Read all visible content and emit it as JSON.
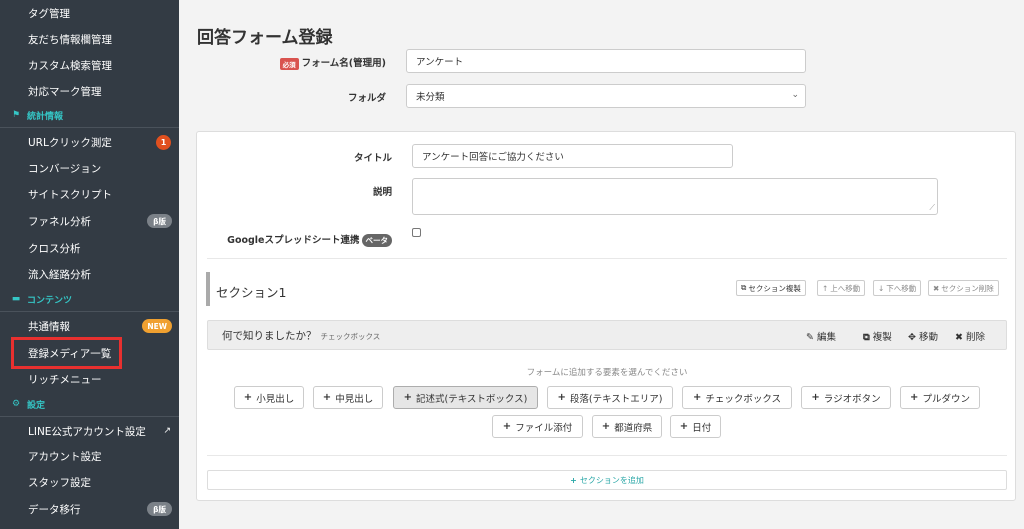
{
  "sidebar": {
    "items": [
      {
        "label": "タグ管理"
      },
      {
        "label": "友だち情報欄管理"
      },
      {
        "label": "カスタム検索管理"
      },
      {
        "label": "対応マーク管理"
      }
    ],
    "stats_section": {
      "label": "統計情報"
    },
    "stats_items": [
      {
        "label": "URLクリック測定",
        "badge": "1"
      },
      {
        "label": "コンバージョン"
      },
      {
        "label": "サイトスクリプト"
      },
      {
        "label": "ファネル分析",
        "badge": "β版"
      },
      {
        "label": "クロス分析"
      },
      {
        "label": "流入経路分析"
      }
    ],
    "content_section": {
      "label": "コンテンツ"
    },
    "content_items": [
      {
        "label": "共通情報",
        "badge": "NEW"
      },
      {
        "label": "登録メディア一覧"
      },
      {
        "label": "リッチメニュー"
      }
    ],
    "settings_section": {
      "label": "設定"
    },
    "settings_items": [
      {
        "label": "LINE公式アカウント設定"
      },
      {
        "label": "アカウント設定"
      },
      {
        "label": "スタッフ設定"
      },
      {
        "label": "データ移行",
        "badge": "β版"
      }
    ]
  },
  "page": {
    "title": "回答フォーム登録",
    "required_badge": "必須",
    "form_name_label": "フォーム名(管理用)",
    "form_name_value": "アンケート",
    "folder_label": "フォルダ",
    "folder_value": "未分類"
  },
  "panel": {
    "title_label": "タイトル",
    "title_value": "アンケート回答にご協力ください",
    "description_label": "説明",
    "description_value": "",
    "google_label": "Googleスプレッドシート連携",
    "google_badge": "ベータ",
    "section": {
      "title": "セクション1",
      "copy_btn": "セクション複製",
      "up_btn": "上へ移動",
      "down_btn": "下へ移動",
      "delete_btn": "セクション削除"
    },
    "question": {
      "text": "何で知りましたか？",
      "type": "チェックボックス",
      "edit": "編集",
      "copy": "複製",
      "move": "移動",
      "delete": "削除"
    },
    "add_hint": "フォームに追加する要素を選んでください",
    "add_buttons": [
      {
        "label": "小見出し"
      },
      {
        "label": "中見出し"
      },
      {
        "label": "記述式(テキストボックス)"
      },
      {
        "label": "段落(テキストエリア)"
      },
      {
        "label": "チェックボックス"
      },
      {
        "label": "ラジオボタン"
      },
      {
        "label": "プルダウン"
      },
      {
        "label": "ファイル添付"
      },
      {
        "label": "都道府県"
      },
      {
        "label": "日付"
      }
    ],
    "add_section": "セクションを追加"
  }
}
